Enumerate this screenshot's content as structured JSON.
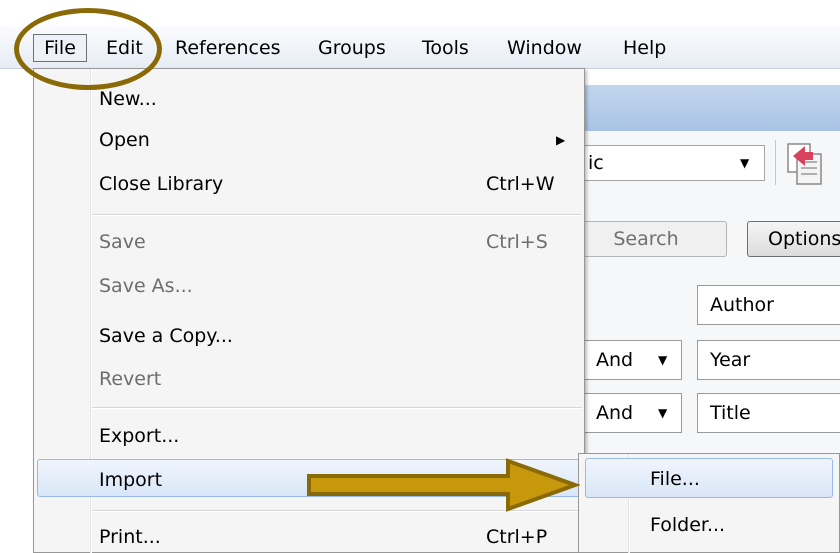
{
  "menubar": {
    "items": [
      "File",
      "Edit",
      "References",
      "Groups",
      "Tools",
      "Window",
      "Help"
    ]
  },
  "app": {
    "style_value": "ic",
    "search_label": "Search",
    "options_label": "Options",
    "fields": [
      "Author",
      "Year",
      "Title"
    ],
    "bool_ops": [
      "And",
      "And"
    ]
  },
  "file_menu": {
    "new": "New...",
    "open": "Open",
    "close": "Close Library",
    "close_shortcut": "Ctrl+W",
    "save": "Save",
    "save_shortcut": "Ctrl+S",
    "save_as": "Save As...",
    "save_copy": "Save a Copy...",
    "revert": "Revert",
    "export": "Export...",
    "import": "Import",
    "print": "Print...",
    "print_shortcut": "Ctrl+P"
  },
  "import_submenu": {
    "items": [
      "File...",
      "Folder..."
    ]
  },
  "colors": {
    "annotation": "#8a6a06",
    "arrow_fill": "#c8980c",
    "highlight": "#d9e6f7"
  }
}
